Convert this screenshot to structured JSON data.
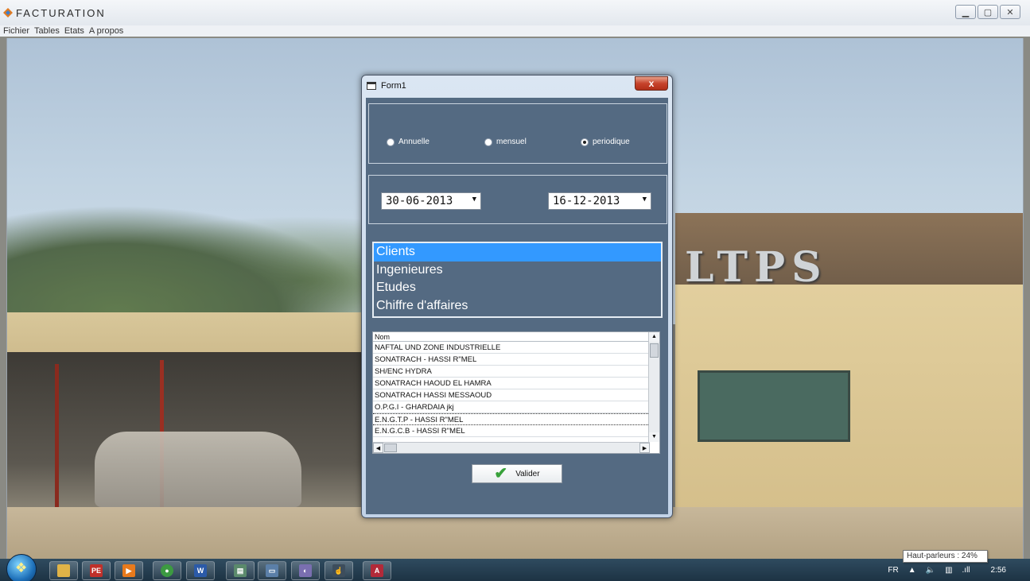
{
  "app": {
    "title": "FACTURATION",
    "window_buttons": {
      "minimize": "▁",
      "maximize": "▢",
      "close": "✕"
    }
  },
  "menu": [
    "Fichier",
    "Tables",
    "Etats",
    "A propos"
  ],
  "background": {
    "sign_text": "LTPS"
  },
  "form1": {
    "title": "Form1",
    "close_label": "x",
    "period_options": [
      {
        "label": "Annuelle",
        "checked": false
      },
      {
        "label": "mensuel",
        "checked": false
      },
      {
        "label": "periodique",
        "checked": true
      }
    ],
    "date_from": "30-06-2013",
    "date_to": "16-12-2013",
    "categories": [
      "Clients",
      "Ingenieures",
      "Etudes",
      "Chiffre d'affaires"
    ],
    "selected_category": "Clients",
    "grid": {
      "header": "Nom",
      "rows": [
        "NAFTAL UND ZONE INDUSTRIELLE",
        "SONATRACH - HASSI R\"MEL",
        "SH/ENC HYDRA",
        "SONATRACH HAOUD EL HAMRA",
        "SONATRACH HASSI MESSAOUD",
        "O.P.G.I - GHARDAIA jkj",
        "E.N.G.T.P - HASSI R\"MEL",
        "E.N.G.C.B - HASSI R\"MEL"
      ]
    },
    "validate_label": "Valider"
  },
  "taskbar": {
    "apps": [
      {
        "name": "explorer",
        "glyph": "",
        "color": "#e0b347"
      },
      {
        "name": "pe",
        "glyph": "PE",
        "color": "#c0302a"
      },
      {
        "name": "media",
        "glyph": "▶",
        "color": "#e87a1c"
      },
      {
        "name": "chrome",
        "glyph": "●",
        "color": "#3c9a41"
      },
      {
        "name": "word",
        "glyph": "W",
        "color": "#2b5aa8"
      },
      {
        "name": "facturation",
        "glyph": "▤",
        "color": "#5b8a6c"
      },
      {
        "name": "window",
        "glyph": "▭",
        "color": "#5b7fa8"
      },
      {
        "name": "paint",
        "glyph": "◐",
        "color": "#7a6fb0"
      },
      {
        "name": "cursor",
        "glyph": "☝",
        "color": "#3d4d5c"
      },
      {
        "name": "access",
        "glyph": "A",
        "color": "#b22a39"
      }
    ],
    "language": "FR",
    "time": "2:56",
    "tooltip": "Haut-parleurs : 24%"
  }
}
